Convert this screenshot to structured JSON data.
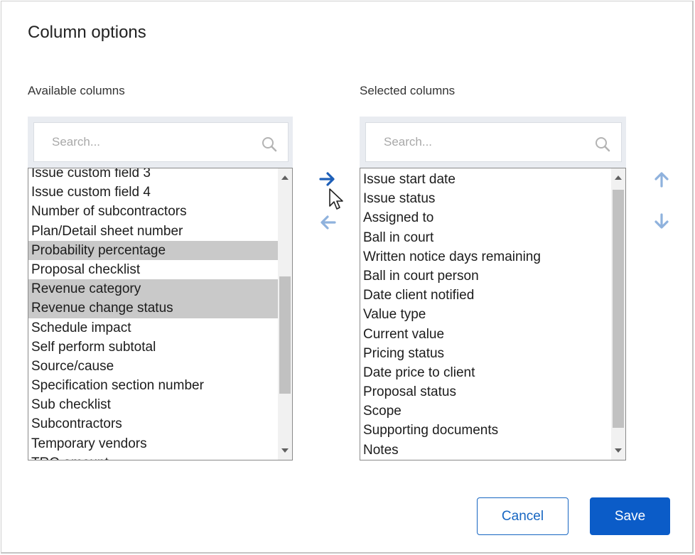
{
  "dialog": {
    "title": "Column options"
  },
  "available": {
    "label": "Available columns",
    "search_placeholder": "Search...",
    "items": [
      {
        "text": "Issue custom field 3",
        "selected": false
      },
      {
        "text": "Issue custom field 4",
        "selected": false
      },
      {
        "text": "Number of subcontractors",
        "selected": false
      },
      {
        "text": "Plan/Detail sheet number",
        "selected": false
      },
      {
        "text": "Probability percentage",
        "selected": true
      },
      {
        "text": "Proposal checklist",
        "selected": false
      },
      {
        "text": "Revenue category",
        "selected": true
      },
      {
        "text": "Revenue change status",
        "selected": true
      },
      {
        "text": "Schedule impact",
        "selected": false
      },
      {
        "text": "Self perform subtotal",
        "selected": false
      },
      {
        "text": "Source/cause",
        "selected": false
      },
      {
        "text": "Specification section number",
        "selected": false
      },
      {
        "text": "Sub checklist",
        "selected": false
      },
      {
        "text": "Subcontractors",
        "selected": false
      },
      {
        "text": "Temporary vendors",
        "selected": false
      },
      {
        "text": "TRO amount",
        "selected": false
      }
    ]
  },
  "selected": {
    "label": "Selected columns",
    "search_placeholder": "Search...",
    "items": [
      {
        "text": "Issue start date",
        "selected": false
      },
      {
        "text": "Issue status",
        "selected": false
      },
      {
        "text": "Assigned to",
        "selected": false
      },
      {
        "text": "Ball in court",
        "selected": false
      },
      {
        "text": "Written notice days remaining",
        "selected": false
      },
      {
        "text": "Ball in court person",
        "selected": false
      },
      {
        "text": "Date client notified",
        "selected": false
      },
      {
        "text": "Value type",
        "selected": false
      },
      {
        "text": "Current value",
        "selected": false
      },
      {
        "text": "Pricing status",
        "selected": false
      },
      {
        "text": "Date price to client",
        "selected": false
      },
      {
        "text": "Proposal status",
        "selected": false
      },
      {
        "text": "Scope",
        "selected": false
      },
      {
        "text": "Supporting documents",
        "selected": false
      },
      {
        "text": "Notes",
        "selected": false
      }
    ]
  },
  "icons": {
    "move_right": "arrow-right-icon",
    "move_left": "arrow-left-icon",
    "move_up": "arrow-up-icon",
    "move_down": "arrow-down-icon",
    "search": "search-icon"
  },
  "colors": {
    "accent": "#0b5cc8",
    "arrow_active": "#1d5fb8",
    "arrow_inactive": "#8fb2dd",
    "selection": "#c9c9c9"
  },
  "buttons": {
    "cancel": "Cancel",
    "save": "Save"
  }
}
